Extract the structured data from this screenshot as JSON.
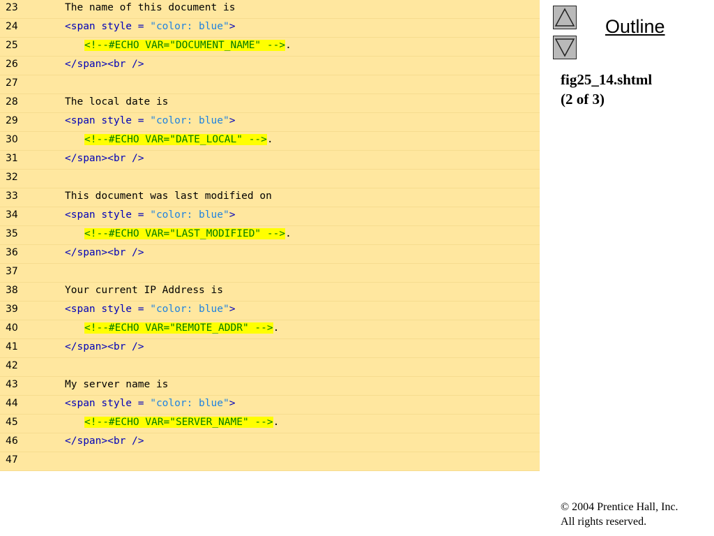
{
  "nav": {
    "up_icon": "triangle-up-icon",
    "down_icon": "triangle-down-icon",
    "outline_label": "Outline"
  },
  "caption": {
    "filename": "fig25_14.shtml",
    "part": "(2 of 3)"
  },
  "footer": {
    "copyright": "© 2004 Prentice Hall, Inc.",
    "rights": "All rights reserved."
  },
  "colors": {
    "code_background": "#ffe79f",
    "tag": "#0000b8",
    "string": "#1e82e0",
    "ssi_directive": "#007a00",
    "ssi_highlight": "#ffff00"
  },
  "code_lines": [
    {
      "num": "23",
      "indent": 1,
      "tokens": [
        {
          "t": "text",
          "v": "The name of this document is"
        }
      ]
    },
    {
      "num": "24",
      "indent": 1,
      "tokens": [
        {
          "t": "tag",
          "v": "<span style = "
        },
        {
          "t": "str",
          "v": "\"color: blue\""
        },
        {
          "t": "tag",
          "v": ">"
        }
      ]
    },
    {
      "num": "25",
      "indent": 2,
      "tokens": [
        {
          "t": "ssi",
          "v": "<!--#ECHO VAR=\"DOCUMENT_NAME\" -->"
        },
        {
          "t": "text",
          "v": "."
        }
      ]
    },
    {
      "num": "26",
      "indent": 1,
      "tokens": [
        {
          "t": "tag",
          "v": "</span><br />"
        }
      ]
    },
    {
      "num": "27",
      "indent": 0,
      "tokens": []
    },
    {
      "num": "28",
      "indent": 1,
      "tokens": [
        {
          "t": "text",
          "v": "The local date is"
        }
      ]
    },
    {
      "num": "29",
      "indent": 1,
      "tokens": [
        {
          "t": "tag",
          "v": "<span style = "
        },
        {
          "t": "str",
          "v": "\"color: blue\""
        },
        {
          "t": "tag",
          "v": ">"
        }
      ]
    },
    {
      "num": "30",
      "indent": 2,
      "tokens": [
        {
          "t": "ssi",
          "v": "<!--#ECHO VAR=\"DATE_LOCAL\" -->"
        },
        {
          "t": "text",
          "v": "."
        }
      ]
    },
    {
      "num": "31",
      "indent": 1,
      "tokens": [
        {
          "t": "tag",
          "v": "</span><br />"
        }
      ]
    },
    {
      "num": "32",
      "indent": 0,
      "tokens": []
    },
    {
      "num": "33",
      "indent": 1,
      "tokens": [
        {
          "t": "text",
          "v": "This document was last modified on"
        }
      ]
    },
    {
      "num": "34",
      "indent": 1,
      "tokens": [
        {
          "t": "tag",
          "v": "<span style = "
        },
        {
          "t": "str",
          "v": "\"color: blue\""
        },
        {
          "t": "tag",
          "v": ">"
        }
      ]
    },
    {
      "num": "35",
      "indent": 2,
      "tokens": [
        {
          "t": "ssi",
          "v": "<!--#ECHO VAR=\"LAST_MODIFIED\" -->"
        },
        {
          "t": "text",
          "v": "."
        }
      ]
    },
    {
      "num": "36",
      "indent": 1,
      "tokens": [
        {
          "t": "tag",
          "v": "</span><br />"
        }
      ]
    },
    {
      "num": "37",
      "indent": 0,
      "tokens": []
    },
    {
      "num": "38",
      "indent": 1,
      "tokens": [
        {
          "t": "text",
          "v": "Your current IP Address is"
        }
      ]
    },
    {
      "num": "39",
      "indent": 1,
      "tokens": [
        {
          "t": "tag",
          "v": "<span style = "
        },
        {
          "t": "str",
          "v": "\"color: blue\""
        },
        {
          "t": "tag",
          "v": ">"
        }
      ]
    },
    {
      "num": "40",
      "indent": 2,
      "tokens": [
        {
          "t": "ssi",
          "v": "<!--#ECHO VAR=\"REMOTE_ADDR\" -->"
        },
        {
          "t": "text",
          "v": "."
        }
      ]
    },
    {
      "num": "41",
      "indent": 1,
      "tokens": [
        {
          "t": "tag",
          "v": "</span><br />"
        }
      ]
    },
    {
      "num": "42",
      "indent": 0,
      "tokens": []
    },
    {
      "num": "43",
      "indent": 1,
      "tokens": [
        {
          "t": "text",
          "v": "My server name is"
        }
      ]
    },
    {
      "num": "44",
      "indent": 1,
      "tokens": [
        {
          "t": "tag",
          "v": "<span style = "
        },
        {
          "t": "str",
          "v": "\"color: blue\""
        },
        {
          "t": "tag",
          "v": ">"
        }
      ]
    },
    {
      "num": "45",
      "indent": 2,
      "tokens": [
        {
          "t": "ssi",
          "v": "<!--#ECHO VAR=\"SERVER_NAME\" -->"
        },
        {
          "t": "text",
          "v": "."
        }
      ]
    },
    {
      "num": "46",
      "indent": 1,
      "tokens": [
        {
          "t": "tag",
          "v": "</span><br />"
        }
      ]
    },
    {
      "num": "47",
      "indent": 0,
      "tokens": []
    }
  ]
}
